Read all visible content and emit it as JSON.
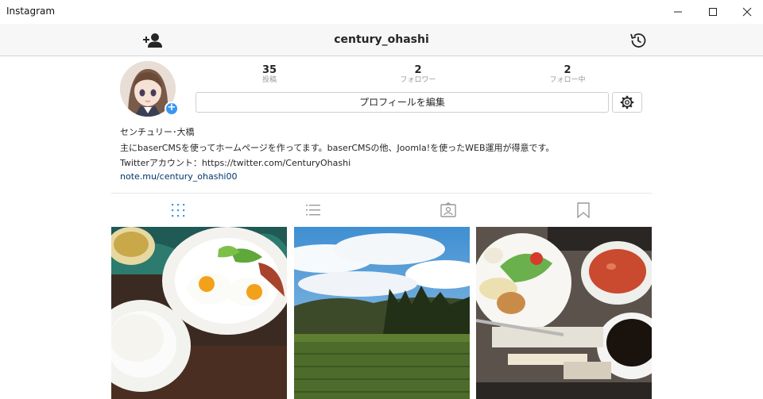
{
  "window": {
    "title": "Instagram"
  },
  "navbar": {
    "username": "century_ohashi"
  },
  "profile": {
    "stats": [
      {
        "count": "35",
        "label": "投稿"
      },
      {
        "count": "2",
        "label": "フォロワー"
      },
      {
        "count": "2",
        "label": "フォロー中"
      }
    ],
    "edit_profile_label": "プロフィールを編集",
    "bio": {
      "name": "センチュリー･大橋",
      "line1": "主にbaserCMSを使ってホームページを作ってます。baserCMSの他、Joomla!を使ったWEB運用が得意です。",
      "line2": "Twitterアカウント：https://twitter.com/CenturyOhashi",
      "website": "note.mu/century_ohashi00"
    }
  },
  "tabs": [
    {
      "icon": "grid-icon",
      "active": true
    },
    {
      "icon": "list-icon",
      "active": false
    },
    {
      "icon": "tagged-icon",
      "active": false
    },
    {
      "icon": "bookmark-icon",
      "active": false
    }
  ],
  "colors": {
    "accent": "#3897f0",
    "link": "#003569",
    "navbar_bg": "#f7f7f7"
  },
  "photos": [
    {
      "subject": "breakfast-plate"
    },
    {
      "subject": "landscape-sky"
    },
    {
      "subject": "lunch-tray"
    }
  ]
}
